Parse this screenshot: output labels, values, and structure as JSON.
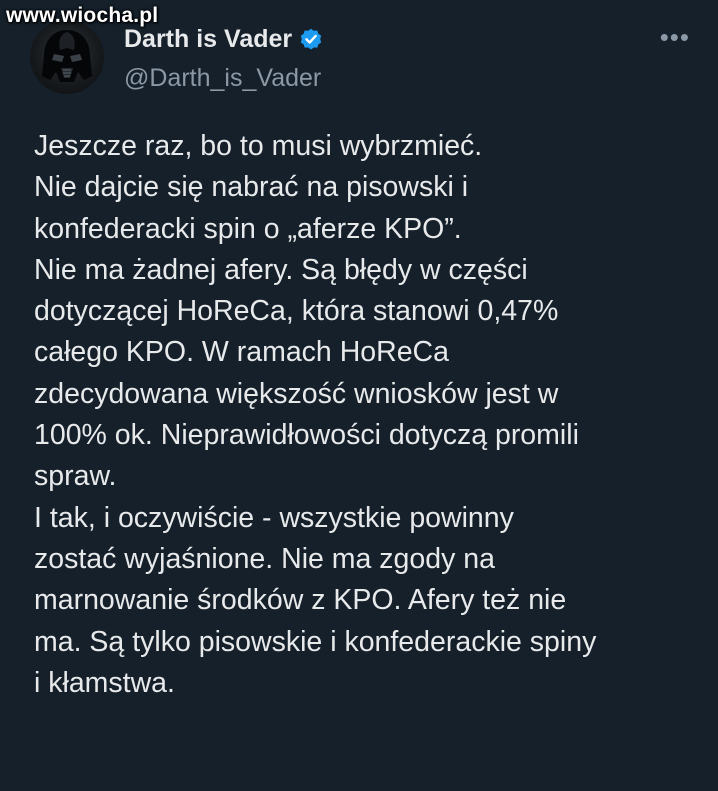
{
  "watermark": "www.wiocha.pl",
  "author": {
    "display_name": "Darth is Vader",
    "handle": "@Darth_is_Vader",
    "avatar_icon": "darth-vader-helmet-icon",
    "verified_icon": "verified-badge-icon",
    "verified_color": "#1d9bf0"
  },
  "more_icon": "more-options-icon",
  "more_label": "•••",
  "tweet": {
    "lines": [
      "Jeszcze raz, bo to musi wybrzmieć.",
      "Nie dajcie się nabrać na pisowski i",
      "konfederacki spin o „aferze KPO”.",
      "Nie ma żadnej afery. Są błędy w części",
      "dotyczącej HoReCa, która stanowi 0,47%",
      "całego KPO. W ramach HoReCa",
      "zdecydowana większość wniosków jest w",
      "100% ok. Nieprawidłowości dotyczą promili",
      "spraw.",
      "I tak, i oczywiście - wszystkie powinny",
      "zostać wyjaśnione. Nie ma zgody na",
      "marnowanie środków z KPO. Afery też nie",
      "ma. Są tylko pisowskie i konfederackie spiny",
      "i kłamstwa."
    ]
  },
  "colors": {
    "background": "#15202b",
    "text": "#e7e9ea",
    "secondary_text": "#8b98a5",
    "accent": "#1d9bf0"
  }
}
